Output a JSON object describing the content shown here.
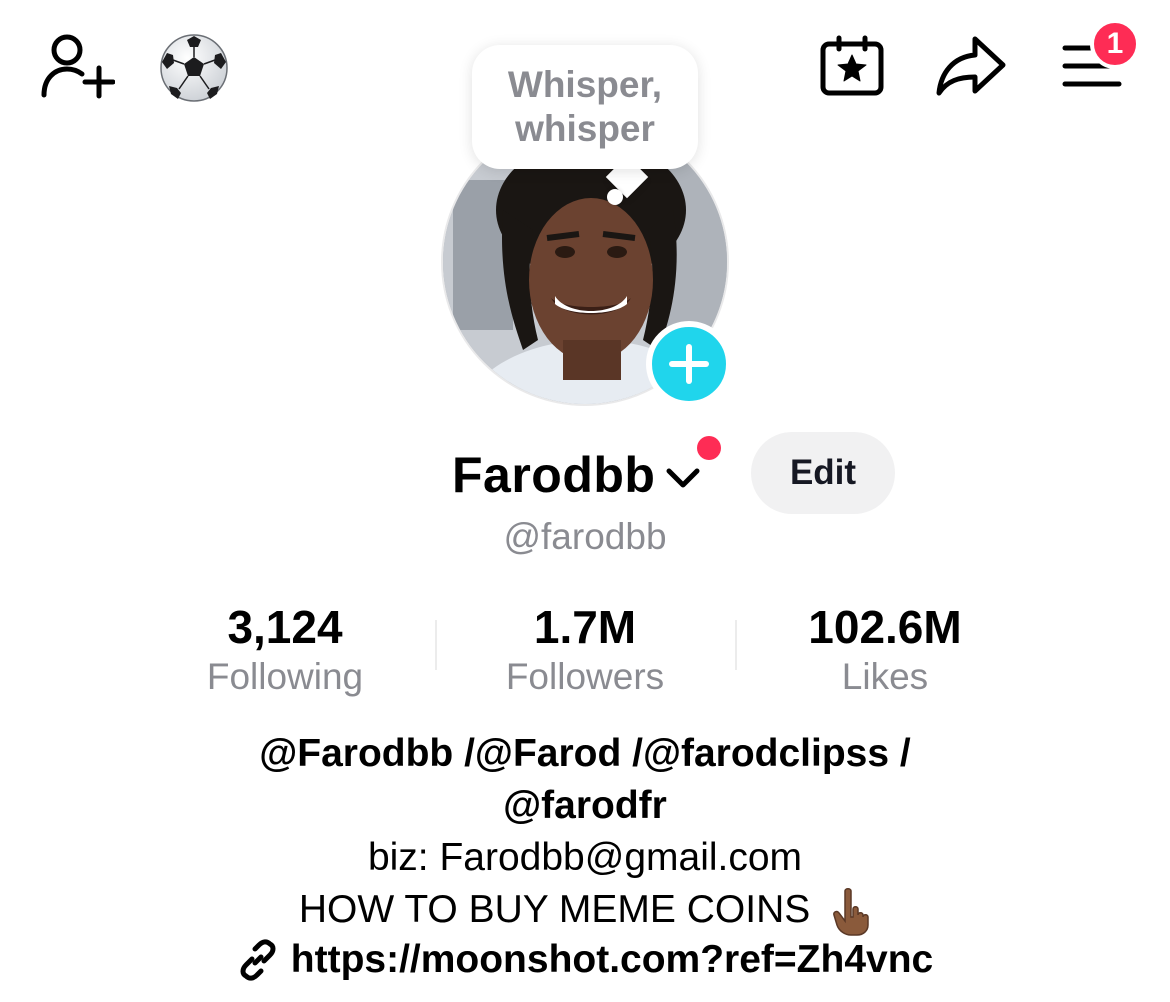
{
  "header": {
    "notifications_badge": "1"
  },
  "whisper": {
    "line1": "Whisper,",
    "line2": "whisper"
  },
  "profile": {
    "display_name": "Farodbb",
    "edit_label": "Edit",
    "handle": "@farodbb"
  },
  "stats": [
    {
      "value": "3,124",
      "label": "Following"
    },
    {
      "value": "1.7M",
      "label": "Followers"
    },
    {
      "value": "102.6M",
      "label": "Likes"
    }
  ],
  "bio": {
    "line1": "@Farodbb  /@Farod  /@farodclipss  /",
    "line2": "@farodfr",
    "line3": "biz: Farodbb@gmail.com",
    "line4": "HOW TO BUY MEME COINS",
    "link": "https://moonshot.com?ref=Zh4vnc"
  },
  "colors": {
    "accent_red": "#fe2c55",
    "add_photo_cyan": "#20d5ec",
    "muted_text": "#8a8b91"
  },
  "icons": [
    "add-friend-icon",
    "soccer-ball-icon",
    "calendar-star-icon",
    "share-icon",
    "menu-icon",
    "plus-icon",
    "chevron-down-icon",
    "link-icon",
    "pointing-down-hand-icon"
  ]
}
